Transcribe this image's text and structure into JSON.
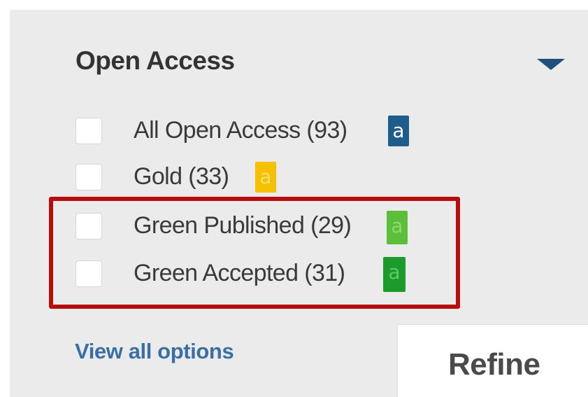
{
  "filter": {
    "title": "Open Access",
    "options": [
      {
        "label": "All Open Access (93)",
        "badge_glyph": "a",
        "badge_color": "#1c5d8c",
        "checked": false
      },
      {
        "label": "Gold (33)",
        "badge_glyph": "a",
        "badge_color": "#f5c000",
        "checked": false
      },
      {
        "label": "Green Published (29)",
        "badge_glyph": "a",
        "badge_color": "#5bbf3a",
        "checked": false
      },
      {
        "label": "Green Accepted (31)",
        "badge_glyph": "a",
        "badge_color": "#1d9a2c",
        "checked": false
      }
    ],
    "view_all_label": "View all options",
    "refine_label": "Refine"
  },
  "colors": {
    "panel_bg": "#ebebeb",
    "highlight": "#b80d0d",
    "link": "#3a6fa5",
    "chevron": "#1f4f7c"
  }
}
